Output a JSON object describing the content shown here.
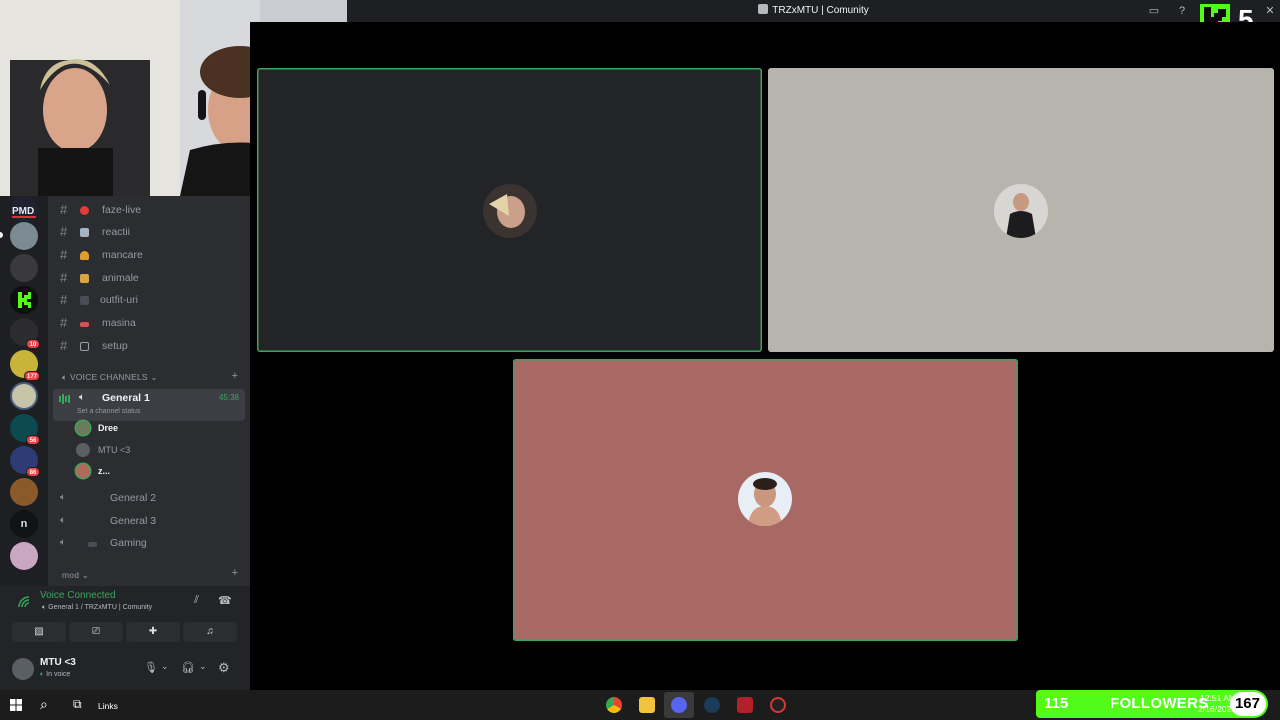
{
  "window": {
    "title": "TRZxMTU | Comunity"
  },
  "overlay": {
    "kick_count": "5",
    "followers_count": "115",
    "followers_label": "FOLLOWERS",
    "followers_goal": "167"
  },
  "channels": [
    {
      "name": "faze-live",
      "icon": "red-circle",
      "color": "#e23b3b"
    },
    {
      "name": "reactii",
      "icon": "film-frame",
      "color": "#a6b3c4"
    },
    {
      "name": "mancare",
      "icon": "burger",
      "color": "#e0a030"
    },
    {
      "name": "animale",
      "icon": "dog",
      "color": "#d9a441"
    },
    {
      "name": "outfit-uri",
      "icon": "shirt",
      "color": "#4a4d55"
    },
    {
      "name": "masina",
      "icon": "car",
      "color": "#d95050"
    },
    {
      "name": "setup",
      "icon": "monitor",
      "color": "#9aa0a8"
    }
  ],
  "voice": {
    "category": "VOICE CHANNELS",
    "active_channel": "General 1",
    "active_timer": "45:38",
    "status_hint": "Set a channel status",
    "members": [
      {
        "name": "Dree",
        "color": "#6a7a5a"
      },
      {
        "name": "MTU <3",
        "color": "#5a5f66"
      },
      {
        "name": "z...",
        "color": "#b06a5a"
      }
    ],
    "other_channels": [
      {
        "name": "General 2"
      },
      {
        "name": "General 3"
      },
      {
        "name": "Gaming"
      }
    ],
    "mod_category": "mod"
  },
  "connection": {
    "status": "Voice Connected",
    "location": "General 1 / TRZxMTU | Comunity"
  },
  "user_panel": {
    "username": "MTU <3",
    "status": "In voice"
  },
  "servers": [
    {
      "name": "pmd",
      "badge": ""
    },
    {
      "name": "server-2",
      "badge": ""
    },
    {
      "name": "server-3",
      "badge": ""
    },
    {
      "name": "kick",
      "badge": ""
    },
    {
      "name": "server-5",
      "badge": "10"
    },
    {
      "name": "server-6",
      "badge": "177"
    },
    {
      "name": "server-7",
      "badge": ""
    },
    {
      "name": "server-8",
      "badge": "56"
    },
    {
      "name": "server-9",
      "badge": "86"
    },
    {
      "name": "server-10",
      "badge": ""
    },
    {
      "name": "n",
      "badge": ""
    },
    {
      "name": "server-12",
      "badge": ""
    }
  ],
  "stage": {
    "tiles": [
      {
        "name": "tile-1",
        "bg": "#232428",
        "speaking": true
      },
      {
        "name": "tile-2",
        "bg": "#b7b4ae",
        "speaking": false
      },
      {
        "name": "tile-3",
        "bg": "#a86864",
        "speaking": true
      }
    ]
  },
  "taskbar": {
    "links_label": "Links",
    "clock_time": "12:51 AM",
    "clock_date": "2/16/2026"
  },
  "colors": {
    "speaking_ring": "#3ba55d",
    "accent_green": "#53fc18",
    "voice_connected": "#3ba55d"
  }
}
